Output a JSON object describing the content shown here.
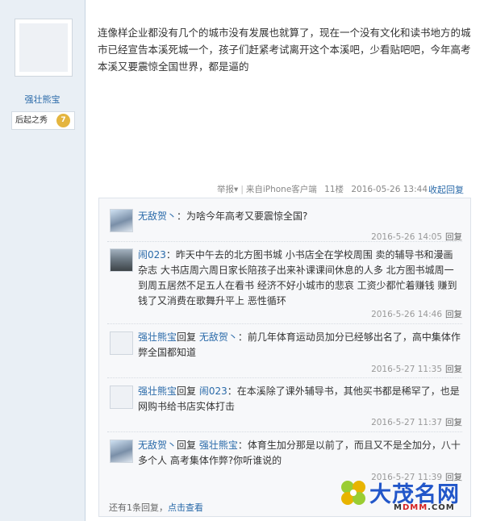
{
  "author": {
    "name": "强壮熊宝",
    "rank_label": "后起之秀",
    "rank_level": "7"
  },
  "post": {
    "text": "连像样企业都没有几个的城市没有发展也就算了，现在一个没有文化和读书地方的城市已经宣告本溪死城一个，孩子们赶紧考试离开这个本溪吧，少看贴吧吧，今年高考本溪又要震惊全国世界，都是逼的",
    "report": "举报",
    "source": "来自iPhone客户端",
    "floor": "11楼",
    "time": "2016-05-26 13:44",
    "collapse": "收起回复"
  },
  "replies": [
    {
      "name": "无敌贺丶",
      "sep": "：",
      "prefix": "",
      "target": "",
      "body": "为啥今年高考又要震惊全国?",
      "time": "2016-5-26 14:05",
      "reply": "回复"
    },
    {
      "name": "闹023",
      "sep": "：",
      "prefix": "",
      "target": "",
      "body": "昨天中午去的北方图书城 小书店全在学校周围 卖的辅导书和漫画杂志 大书店周六周日家长陪孩子出来补课课间休息的人多 北方图书城周一到周五居然不足五人在看书 经济不好小城市的悲哀 工资少都忙着赚钱 赚到钱了又消费在歌舞升平上 恶性循环",
      "time": "2016-5-26 14:46",
      "reply": "回复"
    },
    {
      "name": "强壮熊宝",
      "sep": "：",
      "prefix": "回复 ",
      "target": "无敌贺丶",
      "body": "：前几年体育运动员加分已经够出名了，高中集体作弊全国都知道",
      "time": "2016-5-27 11:35",
      "reply": "回复"
    },
    {
      "name": "强壮熊宝",
      "sep": "：",
      "prefix": "回复 ",
      "target": "闹023",
      "body": "：在本溪除了课外辅导书，其他买书都是稀罕了，也是网购书给书店实体打击",
      "time": "2016-5-27 11:37",
      "reply": "回复"
    },
    {
      "name": "无敌贺丶",
      "sep": "：",
      "prefix": "回复 ",
      "target": "强壮熊宝",
      "body": "：体育生加分那是以前了，而且又不是全加分，八十多个人 高考集体作弊?你听谁说的",
      "time": "2016-5-27 11:39",
      "reply": "回复"
    }
  ],
  "more": {
    "note": "还有1条回复",
    "sep": "，",
    "link": "点击查看"
  },
  "watermark": {
    "title": "大茂名网",
    "url_a": "M",
    "url_b": "DMM",
    "url_c": ".COM"
  }
}
